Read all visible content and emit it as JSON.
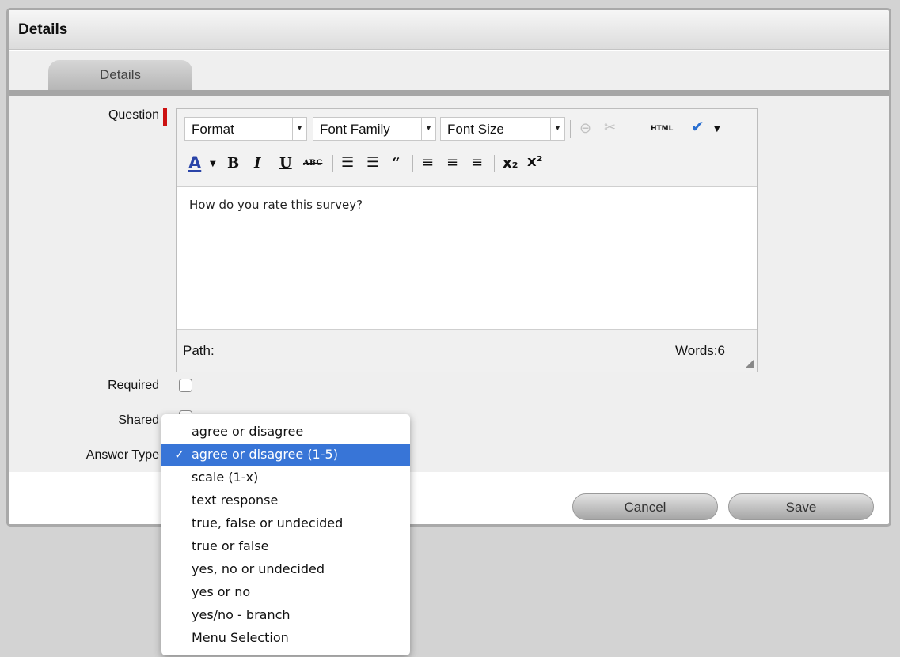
{
  "panel": {
    "title": "Details"
  },
  "tabs": [
    {
      "label": "Details"
    }
  ],
  "form": {
    "question_label": "Question",
    "required_label": "Required",
    "shared_label": "Shared",
    "answer_type_label": "Answer Type"
  },
  "editor": {
    "format": "Format",
    "font_family": "Font Family",
    "font_size": "Font Size",
    "html_label": "HTML",
    "content": "How do you rate this survey?",
    "path_label": "Path:",
    "words_label": "Words:6"
  },
  "buttons": {
    "cancel": "Cancel",
    "save": "Save"
  },
  "answer_type_options": [
    "agree or disagree",
    "agree or disagree (1-5)",
    "scale (1-x)",
    "text response",
    "true, false or undecided",
    "true or false",
    "yes, no or undecided",
    "yes or no",
    "yes/no - branch",
    "Menu Selection"
  ],
  "answer_type_selected": "agree or disagree (1-5)",
  "colors": {
    "selection": "#3875d7",
    "required_mark": "#cc1111",
    "font_color_bar": "#2a44a8"
  }
}
